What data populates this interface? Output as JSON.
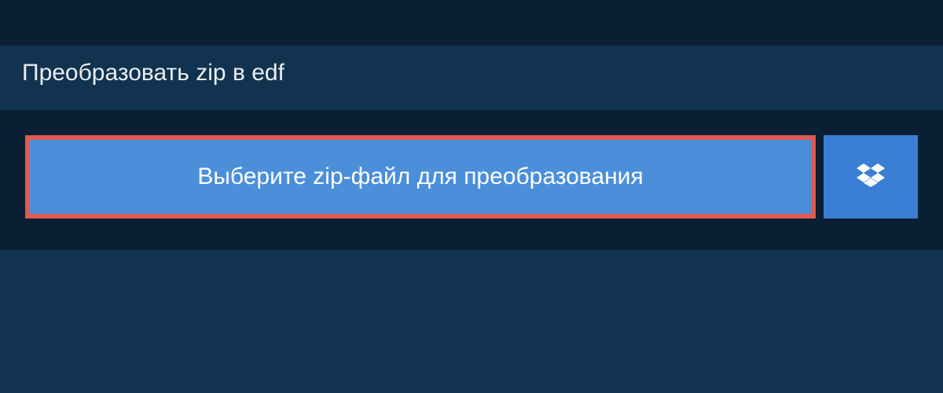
{
  "tab": {
    "title": "Преобразовать zip в edf"
  },
  "actions": {
    "select_file_label": "Выберите zip-файл для преобразования"
  }
}
